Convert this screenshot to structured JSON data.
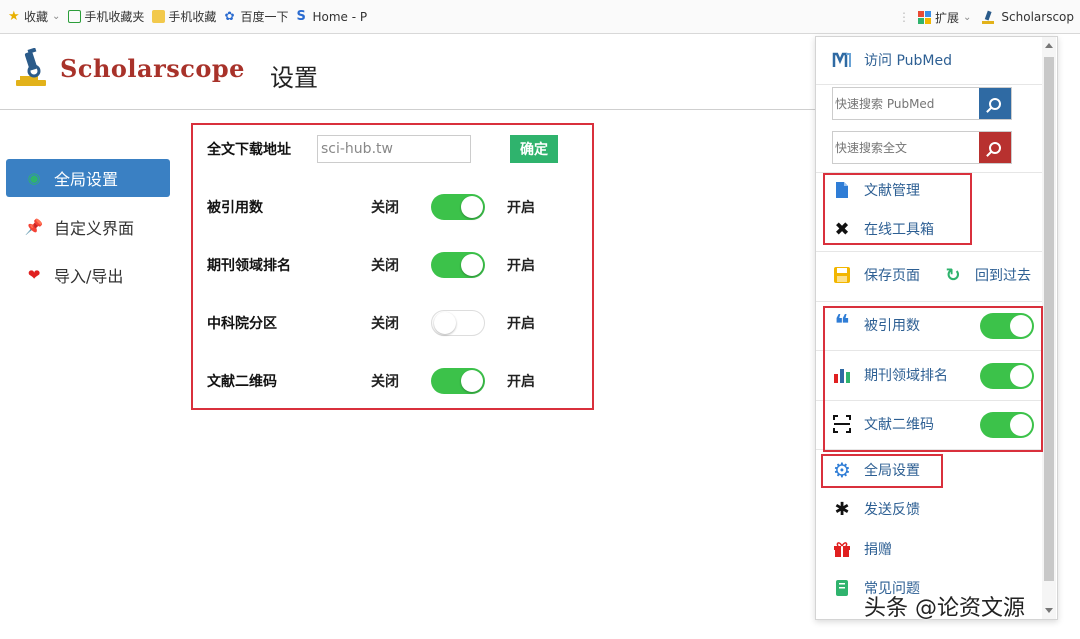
{
  "bookmarks": [
    {
      "label": "收藏",
      "icon": "star-icon"
    },
    {
      "label": "手机收藏夹",
      "icon": "phone-icon"
    },
    {
      "label": "手机收藏",
      "icon": "folder-icon"
    },
    {
      "label": "百度一下",
      "icon": "baidu-paw-icon"
    },
    {
      "label": "Home - P",
      "icon": "s-logo-icon"
    }
  ],
  "toolbar_right": {
    "extensions_label": "扩展",
    "scholarscope_label": "Scholarscop"
  },
  "header": {
    "logo_text": "Scholarscope",
    "page_title": "设置"
  },
  "menu": [
    {
      "label": "全局设置",
      "icon": "eye-icon",
      "active": true
    },
    {
      "label": "自定义界面",
      "icon": "pin-icon",
      "active": false
    },
    {
      "label": "导入/导出",
      "icon": "heart-icon",
      "active": false
    }
  ],
  "settings": {
    "download": {
      "label": "全文下载地址",
      "value": "sci-hub.tw",
      "confirm": "确定"
    },
    "off_label": "关闭",
    "on_label": "开启",
    "rows": [
      {
        "label": "被引用数",
        "on": true
      },
      {
        "label": "期刊领域排名",
        "on": true
      },
      {
        "label": "中科院分区",
        "on": false
      },
      {
        "label": "文献二维码",
        "on": true
      }
    ]
  },
  "popup": {
    "visit_pubmed": "访问 PubMed",
    "search_pubmed_placeholder": "快速搜索 PubMed",
    "search_fulltext_placeholder": "快速搜索全文",
    "library": "文献管理",
    "toolbox": "在线工具箱",
    "save_page": "保存页面",
    "go_back": "回到过去",
    "toggles": [
      {
        "label": "被引用数",
        "on": true
      },
      {
        "label": "期刊领域排名",
        "on": true
      },
      {
        "label": "文献二维码",
        "on": true
      }
    ],
    "global_settings": "全局设置",
    "feedback": "发送反馈",
    "donate": "捐赠",
    "faq": "常见问题"
  },
  "watermark": "头条 @论资文源",
  "colors": {
    "accent_blue": "#3a80c3",
    "toggle_green": "#3cc24a",
    "confirm_green": "#2fb36d",
    "highlight_red": "#d9303c",
    "logo_red": "#a8322a",
    "pubmed_btn": "#2f6aa3",
    "fulltext_btn": "#b8312f"
  }
}
